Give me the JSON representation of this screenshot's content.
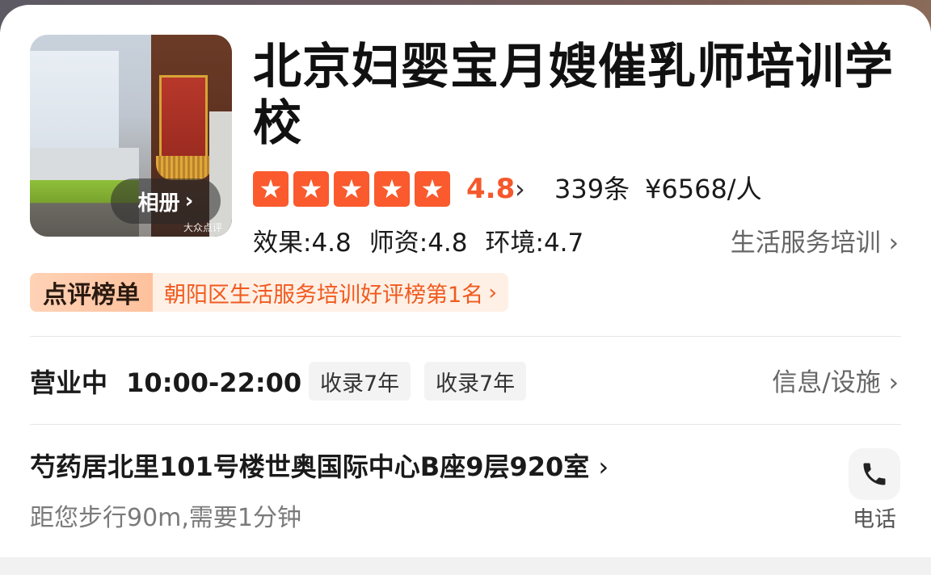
{
  "shop": {
    "title": "北京妇婴宝月嫂催乳师培训学校",
    "album_label": "相册",
    "watermark": "大众点评"
  },
  "rating": {
    "stars": 5,
    "score": "4.8",
    "reviews": "339条",
    "price": "¥6568/人",
    "colors": {
      "star": "#fa5a2d",
      "score": "#f5582b"
    }
  },
  "subscores": {
    "effect": "效果:4.8",
    "teachers": "师资:4.8",
    "environment": "环境:4.7"
  },
  "category": {
    "label": "生活服务培训"
  },
  "ranking": {
    "tag": "点评榜单",
    "text": "朝阳区生活服务培训好评榜第1名"
  },
  "hours": {
    "status": "营业中",
    "time": "10:00-22:00",
    "tags": [
      "收录7年",
      "收录7年"
    ],
    "info_link": "信息/设施"
  },
  "address": {
    "line": "芍药居北里101号楼世奥国际中心B座9层920室",
    "distance": "距您步行90m,需要1分钟"
  },
  "phone": {
    "label": "电话",
    "icon": "phone-icon"
  }
}
